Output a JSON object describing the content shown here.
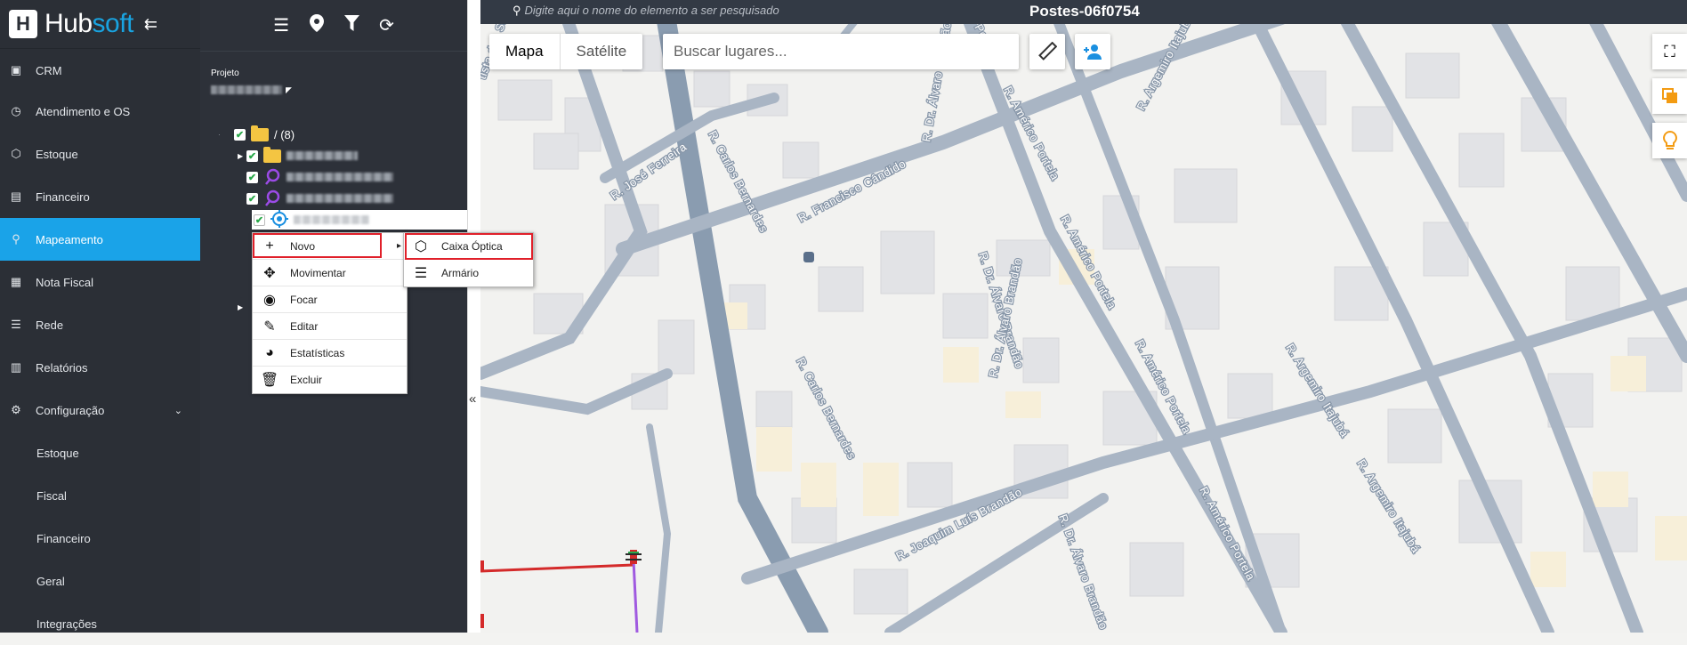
{
  "brand": {
    "name_prefix": "Hub",
    "name_suffix": "soft",
    "collapse_icon": "menu-collapse-icon"
  },
  "nav": {
    "items": [
      {
        "label": "CRM",
        "icon": "crm-icon"
      },
      {
        "label": "Atendimento e OS",
        "icon": "calendar-icon"
      },
      {
        "label": "Estoque",
        "icon": "box-icon"
      },
      {
        "label": "Financeiro",
        "icon": "money-icon"
      },
      {
        "label": "Mapeamento",
        "icon": "map-pin-icon",
        "active": true
      },
      {
        "label": "Nota Fiscal",
        "icon": "invoice-icon"
      },
      {
        "label": "Rede",
        "icon": "network-icon"
      },
      {
        "label": "Relatórios",
        "icon": "report-icon"
      },
      {
        "label": "Configuração",
        "icon": "gear-icon"
      }
    ],
    "sub_items": [
      "Estoque",
      "Fiscal",
      "Financeiro",
      "Geral",
      "Integrações"
    ]
  },
  "panel": {
    "project_label": "Projeto",
    "root_label": "/ (8)"
  },
  "context_menu": {
    "items": [
      {
        "label": "Novo",
        "icon": "plus-icon"
      },
      {
        "label": "Movimentar",
        "icon": "move-icon"
      },
      {
        "label": "Focar",
        "icon": "focus-pin-icon"
      },
      {
        "label": "Editar",
        "icon": "pencil-icon"
      },
      {
        "label": "Estatísticas",
        "icon": "pie-chart-icon"
      },
      {
        "label": "Excluir",
        "icon": "trash-icon"
      }
    ],
    "submenu": [
      {
        "label": "Caixa Óptica",
        "icon": "cube-icon"
      },
      {
        "label": "Armário",
        "icon": "cabinet-icon"
      }
    ]
  },
  "topbar": {
    "search_placeholder": "Digite aqui o nome do elemento a ser pesquisado",
    "title": "Postes-06f0754"
  },
  "map": {
    "type_buttons": [
      "Mapa",
      "Satélite"
    ],
    "places_placeholder": "Buscar lugares...",
    "streets": [
      "R. José Ferreira",
      "R. Carlos Bernardes",
      "R. Francisco Cândido",
      "R. Dr. Álvaro Brandão",
      "R. Américo Portela",
      "R. Argemiro Itajubá",
      "R. Joaquim Luís Brandão",
      "tista dos Santos",
      "Portela"
    ]
  }
}
